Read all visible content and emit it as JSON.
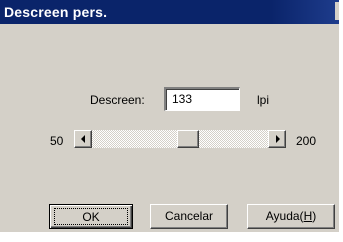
{
  "window": {
    "title": "Descreen pers."
  },
  "descreen": {
    "label": "Descreen:",
    "value": "133",
    "unit": "lpi"
  },
  "slider": {
    "min_label": "50",
    "max_label": "200",
    "min": 50,
    "max": 200,
    "value": 133
  },
  "buttons": {
    "ok": "OK",
    "cancel": "Cancelar",
    "help_prefix": "Ayuda(",
    "help_mnemonic": "H",
    "help_suffix": ")"
  }
}
